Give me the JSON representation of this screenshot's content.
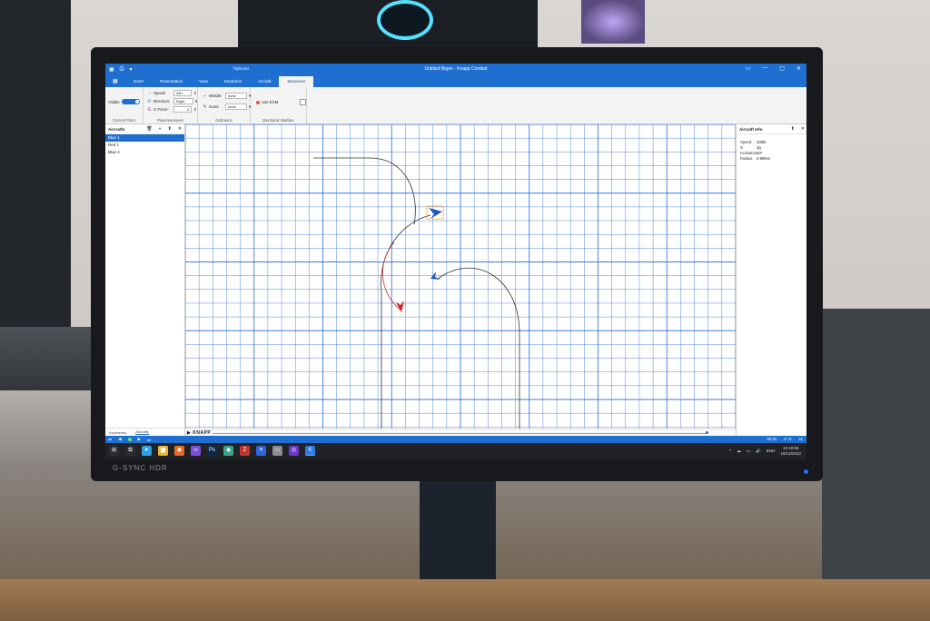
{
  "window": {
    "title": "Untitled Bigen - Knapp Combat",
    "context_tab": "Tilplinnet",
    "quick_access": [
      "▣",
      "⎙",
      "▾"
    ],
    "controls": [
      "▭",
      "—",
      "▢",
      "✕"
    ]
  },
  "ribbon": {
    "file_tab": "▦",
    "tabs": [
      "Insert",
      "Presentation",
      "View",
      "Keyframe",
      "Aircraft",
      "Maneuver"
    ],
    "active_tab": "Maneuver",
    "current_point": {
      "visible_label": "Visible",
      "group_label": "Current Point"
    },
    "planemaneuver": {
      "speed_label": "Speed:",
      "speed_value": "330",
      "direction_label": "Direction:",
      "direction_value": "Right",
      "gforce_label": "G Force:",
      "gforce_value": "3",
      "group_label": "Planemaneuver"
    },
    "ordnance": {
      "missile_label": "Missile:",
      "missile_value": "none",
      "guns_label": "Guns:",
      "guns_value": "none",
      "group_label": "Ordnance"
    },
    "ew": {
      "use_label": "Use ECM",
      "group_label": "Electronic Warfare"
    }
  },
  "aircrafts_panel": {
    "title": "Aircrafts",
    "tools": [
      "🗑",
      "+",
      "⬆",
      "✕"
    ],
    "items": [
      "Blue 1",
      "Red 1",
      "Blue 2"
    ],
    "selected": "Blue 1",
    "bottom_tabs": [
      "Keyframes",
      "Aircrafts"
    ]
  },
  "info_panel": {
    "title": "Aircraft Info",
    "pin": "✕",
    "rows": [
      {
        "k": "Speed",
        "v": "330kt"
      },
      {
        "k": "G",
        "v": "3g"
      },
      {
        "k": "Inclination",
        "v": "10º"
      },
      {
        "k": "Radius",
        "v": "0.95Nm"
      }
    ]
  },
  "brand": "▶ KNAPP",
  "statusbar": {
    "left_icons": [
      "⏮",
      "◀",
      "●",
      "▶",
      "⏭"
    ],
    "time": "00:16",
    "frame": "4 / 5",
    "speed": "x1"
  },
  "taskbar": {
    "apps": [
      {
        "glyph": "⊞",
        "color": "#2b2d31"
      },
      {
        "glyph": "⧉",
        "color": "#2b2d31"
      },
      {
        "glyph": "➤",
        "color": "#2ea0e5"
      },
      {
        "glyph": "▆",
        "color": "#e9b43a"
      },
      {
        "glyph": "◉",
        "color": "#e46b2a"
      },
      {
        "glyph": "∞",
        "color": "#7b4fd6"
      },
      {
        "glyph": "Ps",
        "color": "#0b2a4d"
      },
      {
        "glyph": "◆",
        "color": "#3fa28c"
      },
      {
        "glyph": "Z",
        "color": "#c2362b"
      },
      {
        "glyph": "✈",
        "color": "#2f64d6"
      },
      {
        "glyph": "▭",
        "color": "#8a8d92"
      },
      {
        "glyph": "◎",
        "color": "#6e38c8"
      },
      {
        "glyph": "K",
        "color": "#2f7be2"
      }
    ],
    "tray": [
      "^",
      "☁",
      "▭",
      "🔊"
    ],
    "lang": "ENG",
    "time": "12:18:55",
    "date": "18/12/2022"
  },
  "monitor": {
    "brand_text": "G-SYNC HDR"
  },
  "colors": {
    "accent": "#1f6fd1",
    "grid": "#3f7bd4",
    "blue_plane": "#1a56c2",
    "red_plane": "#e02020"
  }
}
